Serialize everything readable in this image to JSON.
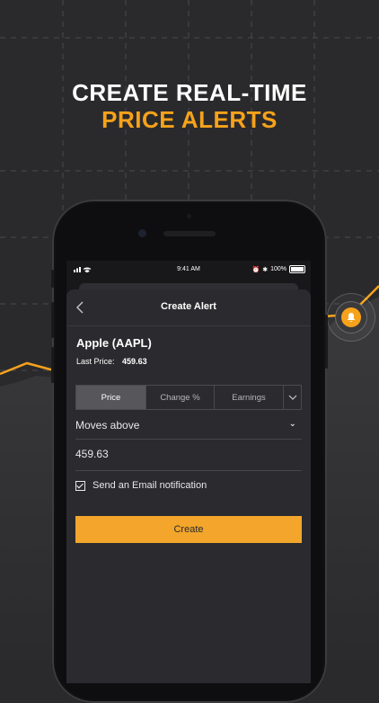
{
  "headline": {
    "line1": "CREATE REAL-TIME",
    "line2": "PRICE ALERTS"
  },
  "colors": {
    "accent": "#f7a21b",
    "background": "#2a2a2c",
    "button": "#f3a62b"
  },
  "status_bar": {
    "time": "9:41 AM",
    "battery": "100%"
  },
  "nav": {
    "title": "Create Alert",
    "back_icon": "chevron-left-icon"
  },
  "stock": {
    "name": "Apple (AAPL)",
    "last_price_label": "Last Price:",
    "last_price_value": "459.63"
  },
  "tabs": [
    {
      "label": "Price",
      "active": true
    },
    {
      "label": "Change %",
      "active": false
    },
    {
      "label": "Earnings",
      "active": false
    }
  ],
  "condition": {
    "value": "Moves above"
  },
  "price_input": {
    "value": "459.63"
  },
  "email_option": {
    "label": "Send an Email notification",
    "checked": true
  },
  "create_button": {
    "label": "Create"
  }
}
